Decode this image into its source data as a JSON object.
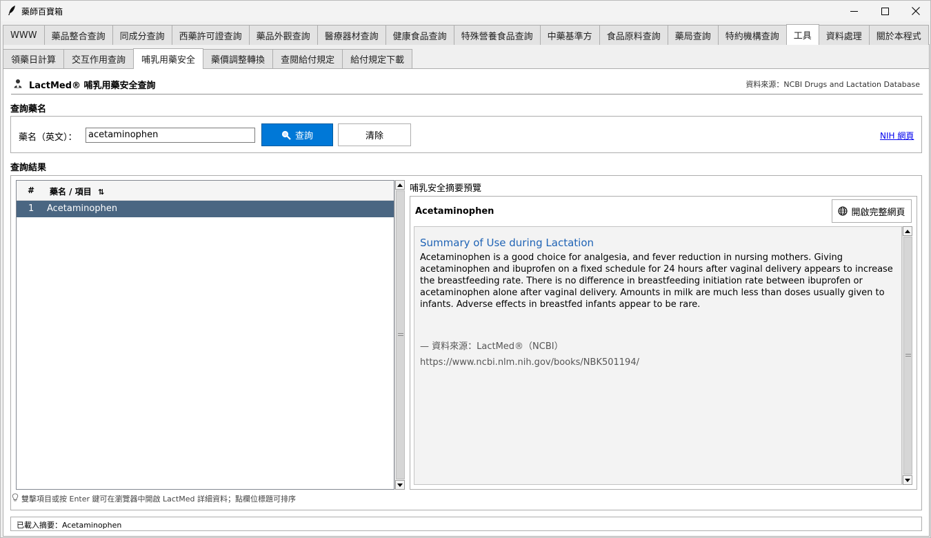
{
  "window": {
    "title": "藥師百寶箱",
    "icons": {
      "app": "quill-icon",
      "minimize": "minimize-icon",
      "maximize": "maximize-icon",
      "close": "close-icon"
    }
  },
  "main_tabs": [
    {
      "label": "WWW"
    },
    {
      "label": "藥品整合查詢"
    },
    {
      "label": "同成分查詢"
    },
    {
      "label": "西藥許可證查詢"
    },
    {
      "label": "藥品外觀查詢"
    },
    {
      "label": "醫療器材查詢"
    },
    {
      "label": "健康食品查詢"
    },
    {
      "label": "特殊營養食品查詢"
    },
    {
      "label": "中藥基準方"
    },
    {
      "label": "食品原料查詢"
    },
    {
      "label": "藥局查詢"
    },
    {
      "label": "特約機構查詢"
    },
    {
      "label": "工具",
      "active": true
    },
    {
      "label": "資料處理"
    },
    {
      "label": "關於本程式"
    }
  ],
  "sub_tabs": [
    {
      "label": "領藥日計算"
    },
    {
      "label": "交互作用查詢"
    },
    {
      "label": "哺乳用藥安全",
      "active": true
    },
    {
      "label": "藥價調整轉換"
    },
    {
      "label": "查閱給付規定"
    },
    {
      "label": "給付規定下載"
    }
  ],
  "header": {
    "title": "LactMed® 哺乳用藥安全查詢",
    "source": "資料來源：NCBI Drugs and Lactation Database",
    "icon": "person-icon"
  },
  "query": {
    "section_label": "查詢藥名",
    "drug_label": "藥名（英文）：",
    "drug_value": "acetaminophen",
    "search_label": "查詢",
    "clear_label": "清除",
    "nih_link": "NIH 網頁",
    "search_icon": "magnifier-icon"
  },
  "results": {
    "section_label": "查詢結果",
    "columns": {
      "num": "#",
      "name": "藥名 / 項目",
      "sort_icon": "⇅"
    },
    "rows": [
      {
        "num": "1",
        "name": "Acetaminophen",
        "selected": true
      }
    ]
  },
  "preview": {
    "label": "哺乳安全摘要預覽",
    "drug": "Acetaminophen",
    "open_button": "開啟完整網頁",
    "open_icon": "globe-icon",
    "summary_heading": "Summary of Use during Lactation",
    "summary_text": "Acetaminophen is a good choice for analgesia, and fever reduction in nursing mothers. Giving acetaminophen and ibuprofen on a fixed schedule for 24 hours after vaginal delivery appears to increase the breastfeeding rate. There is no difference in breastfeeding initiation rate between ibuprofen or acetaminophen alone after vaginal delivery. Amounts in milk are much less than doses usually given to infants. Adverse effects in breastfed infants appear to be rare.",
    "source_line": "— 資料來源：LactMed®（NCBI）",
    "source_url": "https://www.ncbi.nlm.nih.gov/books/NBK501194/"
  },
  "hint": "雙擊項目或按 Enter 鍵可在瀏覽器中開啟 LactMed 詳細資料；點欄位標題可排序",
  "status": "已載入摘要：Acetaminophen",
  "colors": {
    "accent": "#0078d7",
    "selection": "#4a6682",
    "heading": "#1f63b5",
    "link": "#0000ee"
  }
}
